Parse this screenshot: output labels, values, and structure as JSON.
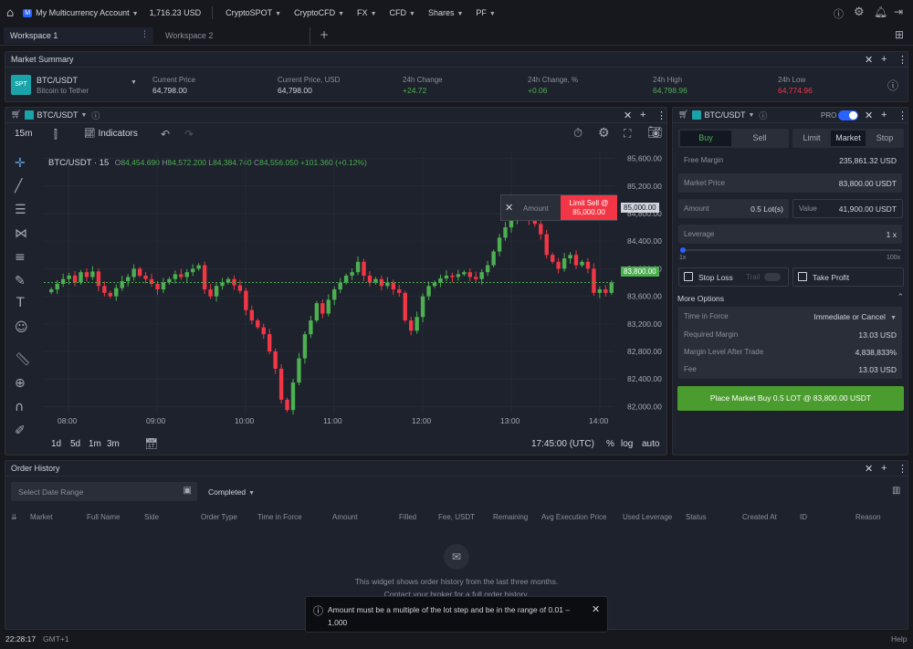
{
  "topbar": {
    "account_badge": "M",
    "account": "My Multicurrency Account",
    "balance": "1,716.23 USD",
    "menus": [
      "CryptoSPOT",
      "CryptoCFD",
      "FX",
      "CFD",
      "Shares",
      "PF"
    ]
  },
  "workspaces": [
    "Workspace 1",
    "Workspace 2"
  ],
  "market_summary": {
    "title": "Market Summary",
    "badge": "SPT",
    "symbol": "BTC/USDT",
    "subtitle": "Bitcoin to Tether",
    "cols": [
      {
        "label": "Current Price",
        "value": "64,798.00",
        "color": "#d1d4dc"
      },
      {
        "label": "Current Price, USD",
        "value": "64,798.00",
        "color": "#d1d4dc"
      },
      {
        "label": "24h Change",
        "value": "+24.72",
        "color": "#4caf50"
      },
      {
        "label": "24h Change, %",
        "value": "+0.06",
        "color": "#4caf50"
      },
      {
        "label": "24h High",
        "value": "64,798.96",
        "color": "#4caf50"
      },
      {
        "label": "24h Low",
        "value": "64,774.96",
        "color": "#f23645"
      }
    ]
  },
  "chart": {
    "symbol": "BTC/USDT",
    "interval": "15m",
    "indicators": "Indicators",
    "legend_symbol": "BTC/USDT · 15",
    "ohlc": {
      "o": "84,454.690",
      "h": "84,572.200",
      "l": "84,384.740",
      "c": "84,556.050",
      "chg": "+101.360 (+0.12%)"
    },
    "o_label": "O",
    "h_label": "H",
    "l_label": "L",
    "c_label": "C",
    "amount_label": "Amount",
    "limit_label": "Limit Sell @",
    "limit_price": "85,000.00",
    "limit_tag": "85,000.00",
    "last_price": "83,800.00",
    "time_axis": "17:45:00 (UTC)",
    "ranges": [
      "1d",
      "5d",
      "1m",
      "3m"
    ],
    "opts": [
      "%",
      "log",
      "auto"
    ]
  },
  "chart_data": {
    "type": "candlestick",
    "x_ticks": [
      "08:00",
      "09:00",
      "10:00",
      "11:00",
      "12:00",
      "13:00",
      "14:00"
    ],
    "y_ticks": [
      "85,600.00",
      "85,200.00",
      "84,800.00",
      "84,400.00",
      "84,000.00",
      "83,600.00",
      "83,200.00",
      "82,800.00",
      "82,400.00",
      "82,000.00"
    ],
    "ylim": [
      81900,
      85700
    ],
    "closes": [
      83700,
      83780,
      83850,
      83900,
      83800,
      83950,
      83880,
      83960,
      83750,
      83650,
      83600,
      83720,
      83820,
      83880,
      84000,
      83900,
      83850,
      83780,
      83700,
      83800,
      83850,
      83920,
      83880,
      83950,
      84000,
      84050,
      83700,
      83600,
      83750,
      83800,
      83850,
      83760,
      83680,
      83400,
      83250,
      83150,
      83050,
      82800,
      82550,
      82100,
      81950,
      82350,
      82700,
      83050,
      83250,
      83500,
      83350,
      83550,
      83700,
      83800,
      83900,
      83950,
      84100,
      83900,
      83800,
      83850,
      83750,
      83800,
      83700,
      83650,
      83250,
      83100,
      83300,
      83600,
      83750,
      83800,
      83860,
      83900,
      83880,
      83920,
      83950,
      83880,
      83850,
      83950,
      84050,
      84250,
      84450,
      84600,
      84700,
      84750,
      84800,
      84700,
      84650,
      84500,
      84200,
      84100,
      84000,
      84150,
      84200,
      84050,
      84100,
      84000,
      83650,
      83700,
      83650,
      83800
    ]
  },
  "order_panel": {
    "symbol": "BTC/USDT",
    "pro": "PRO",
    "buy": "Buy",
    "sell": "Sell",
    "types": [
      "Limit",
      "Market",
      "Stop"
    ],
    "free_margin_label": "Free Margin",
    "free_margin": "235,861.32 USD",
    "market_price_label": "Market Price",
    "market_price": "83,800.00",
    "market_price_unit": "USDT",
    "amount_label": "Amount",
    "amount": "0.5 Lot(s)",
    "value_label": "Value",
    "value": "41,900.00",
    "value_unit": "USDT",
    "leverage_label": "Leverage",
    "leverage": "1 x",
    "lev_min": "1x",
    "lev_max": "100x",
    "leverage_fraction": 0.0,
    "stop_loss": "Stop Loss",
    "trail": "Trail",
    "take_profit": "Take Profit",
    "more_options": "More Options",
    "tif_label": "Time in Force",
    "tif": "Immediate or Cancel",
    "req_margin_label": "Required Margin",
    "req_margin": "13.03 USD",
    "margin_level_label": "Margin Level After Trade",
    "margin_level": "4,838,833%",
    "fee_label": "Fee",
    "fee": "13.03 USD",
    "place": "Place Market Buy 0.5 LOT @ 83,800.00 USDT"
  },
  "order_history": {
    "title": "Order History",
    "date_placeholder": "Select Date Range",
    "status": "Completed",
    "columns": [
      "Market",
      "Full Name",
      "Side",
      "Order Type",
      "Time in Force",
      "Amount",
      "Filled",
      "Fee, USDT",
      "Remaining",
      "Avg Execution Price",
      "Used Leverage",
      "Status",
      "Created At",
      "ID",
      "Reason"
    ],
    "empty_1": "This widget shows order history from the last three months.",
    "empty_2": "Contact your broker for a full order history."
  },
  "toast": {
    "text": "Amount must be a multiple of the lot step and be in the range of 0.01 – 1,000"
  },
  "status": {
    "time": "22:28:17",
    "tz": "GMT+1",
    "help": "Help"
  }
}
